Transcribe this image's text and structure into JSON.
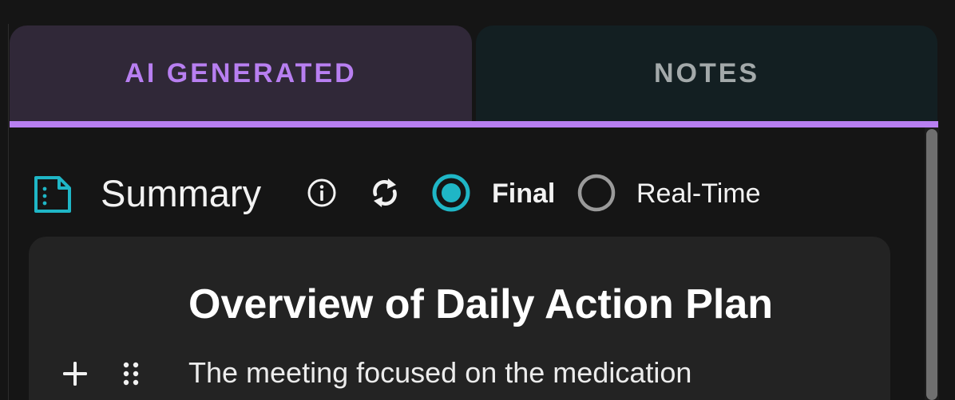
{
  "tabs": [
    {
      "label": "AI GENERATED",
      "active": true
    },
    {
      "label": "NOTES",
      "active": false
    }
  ],
  "section": {
    "icon": "document-icon",
    "title": "Summary"
  },
  "mode": {
    "options": [
      {
        "label": "Final",
        "selected": true
      },
      {
        "label": "Real-Time",
        "selected": false
      }
    ]
  },
  "summary_card": {
    "heading": "Overview of Daily Action Plan",
    "paragraph": "The meeting focused on the medication"
  },
  "colors": {
    "accent_purple": "#b87ff1",
    "accent_teal": "#1fb6c6",
    "background": "#151515",
    "card": "#232323"
  }
}
